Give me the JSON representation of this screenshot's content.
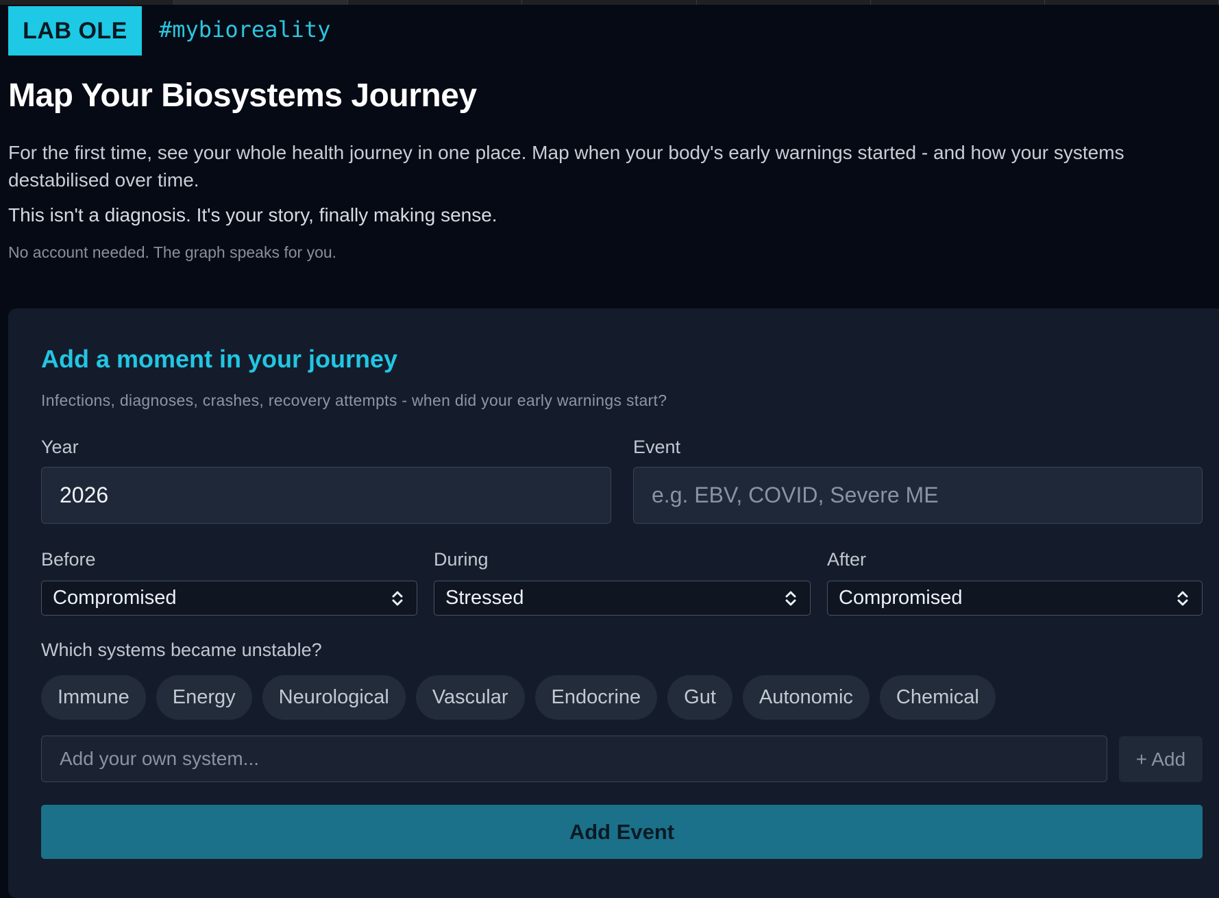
{
  "header": {
    "brand": "LAB OLE",
    "hashtag": "#mybioreality"
  },
  "intro": {
    "title": "Map Your Biosystems Journey",
    "paragraph1": "For the first time, see your whole health journey in one place. Map when your body's early warnings started - and how your systems destabilised over time.",
    "paragraph2": "This isn't a diagnosis. It's your story, finally making sense.",
    "note": "No account needed. The graph speaks for you."
  },
  "form": {
    "title": "Add a moment in your journey",
    "subtitle": "Infections, diagnoses, crashes, recovery attempts - when did your early warnings start?",
    "year_label": "Year",
    "year_value": "2026",
    "event_label": "Event",
    "event_placeholder": "e.g. EBV, COVID, Severe ME",
    "before_label": "Before",
    "before_value": "Compromised",
    "during_label": "During",
    "during_value": "Stressed",
    "after_label": "After",
    "after_value": "Compromised",
    "systems_label": "Which systems became unstable?",
    "systems": [
      "Immune",
      "Energy",
      "Neurological",
      "Vascular",
      "Endocrine",
      "Gut",
      "Autonomic",
      "Chemical"
    ],
    "custom_placeholder": "Add your own system...",
    "add_label": "+ Add",
    "submit_label": "Add Event"
  },
  "colors": {
    "background": "#060a14",
    "card": "#141c2b",
    "accent": "#1ec9e6",
    "button": "#1b7189"
  }
}
